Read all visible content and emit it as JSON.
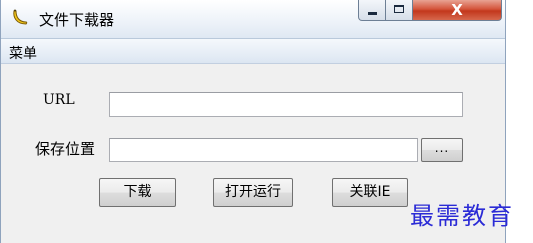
{
  "window": {
    "title": "文件下载器",
    "icon": "banana-app-icon",
    "caption_buttons": {
      "minimize": "minimize-icon",
      "maximize": "maximize-icon",
      "close": "close-icon",
      "close_glyph": "X"
    }
  },
  "menubar": {
    "items": [
      {
        "label": "菜单"
      }
    ]
  },
  "form": {
    "url_label": "URL",
    "url_value": "",
    "save_location_label": "保存位置",
    "save_location_value": "",
    "browse_label": "...",
    "buttons": {
      "download": "下载",
      "open_run": "打开运行",
      "associate_ie": "关联IE"
    }
  },
  "watermark": "最需教育",
  "colors": {
    "close_button": "#c3371c",
    "watermark": "#2b2bd6",
    "title_bar": "#dfe8f3"
  }
}
